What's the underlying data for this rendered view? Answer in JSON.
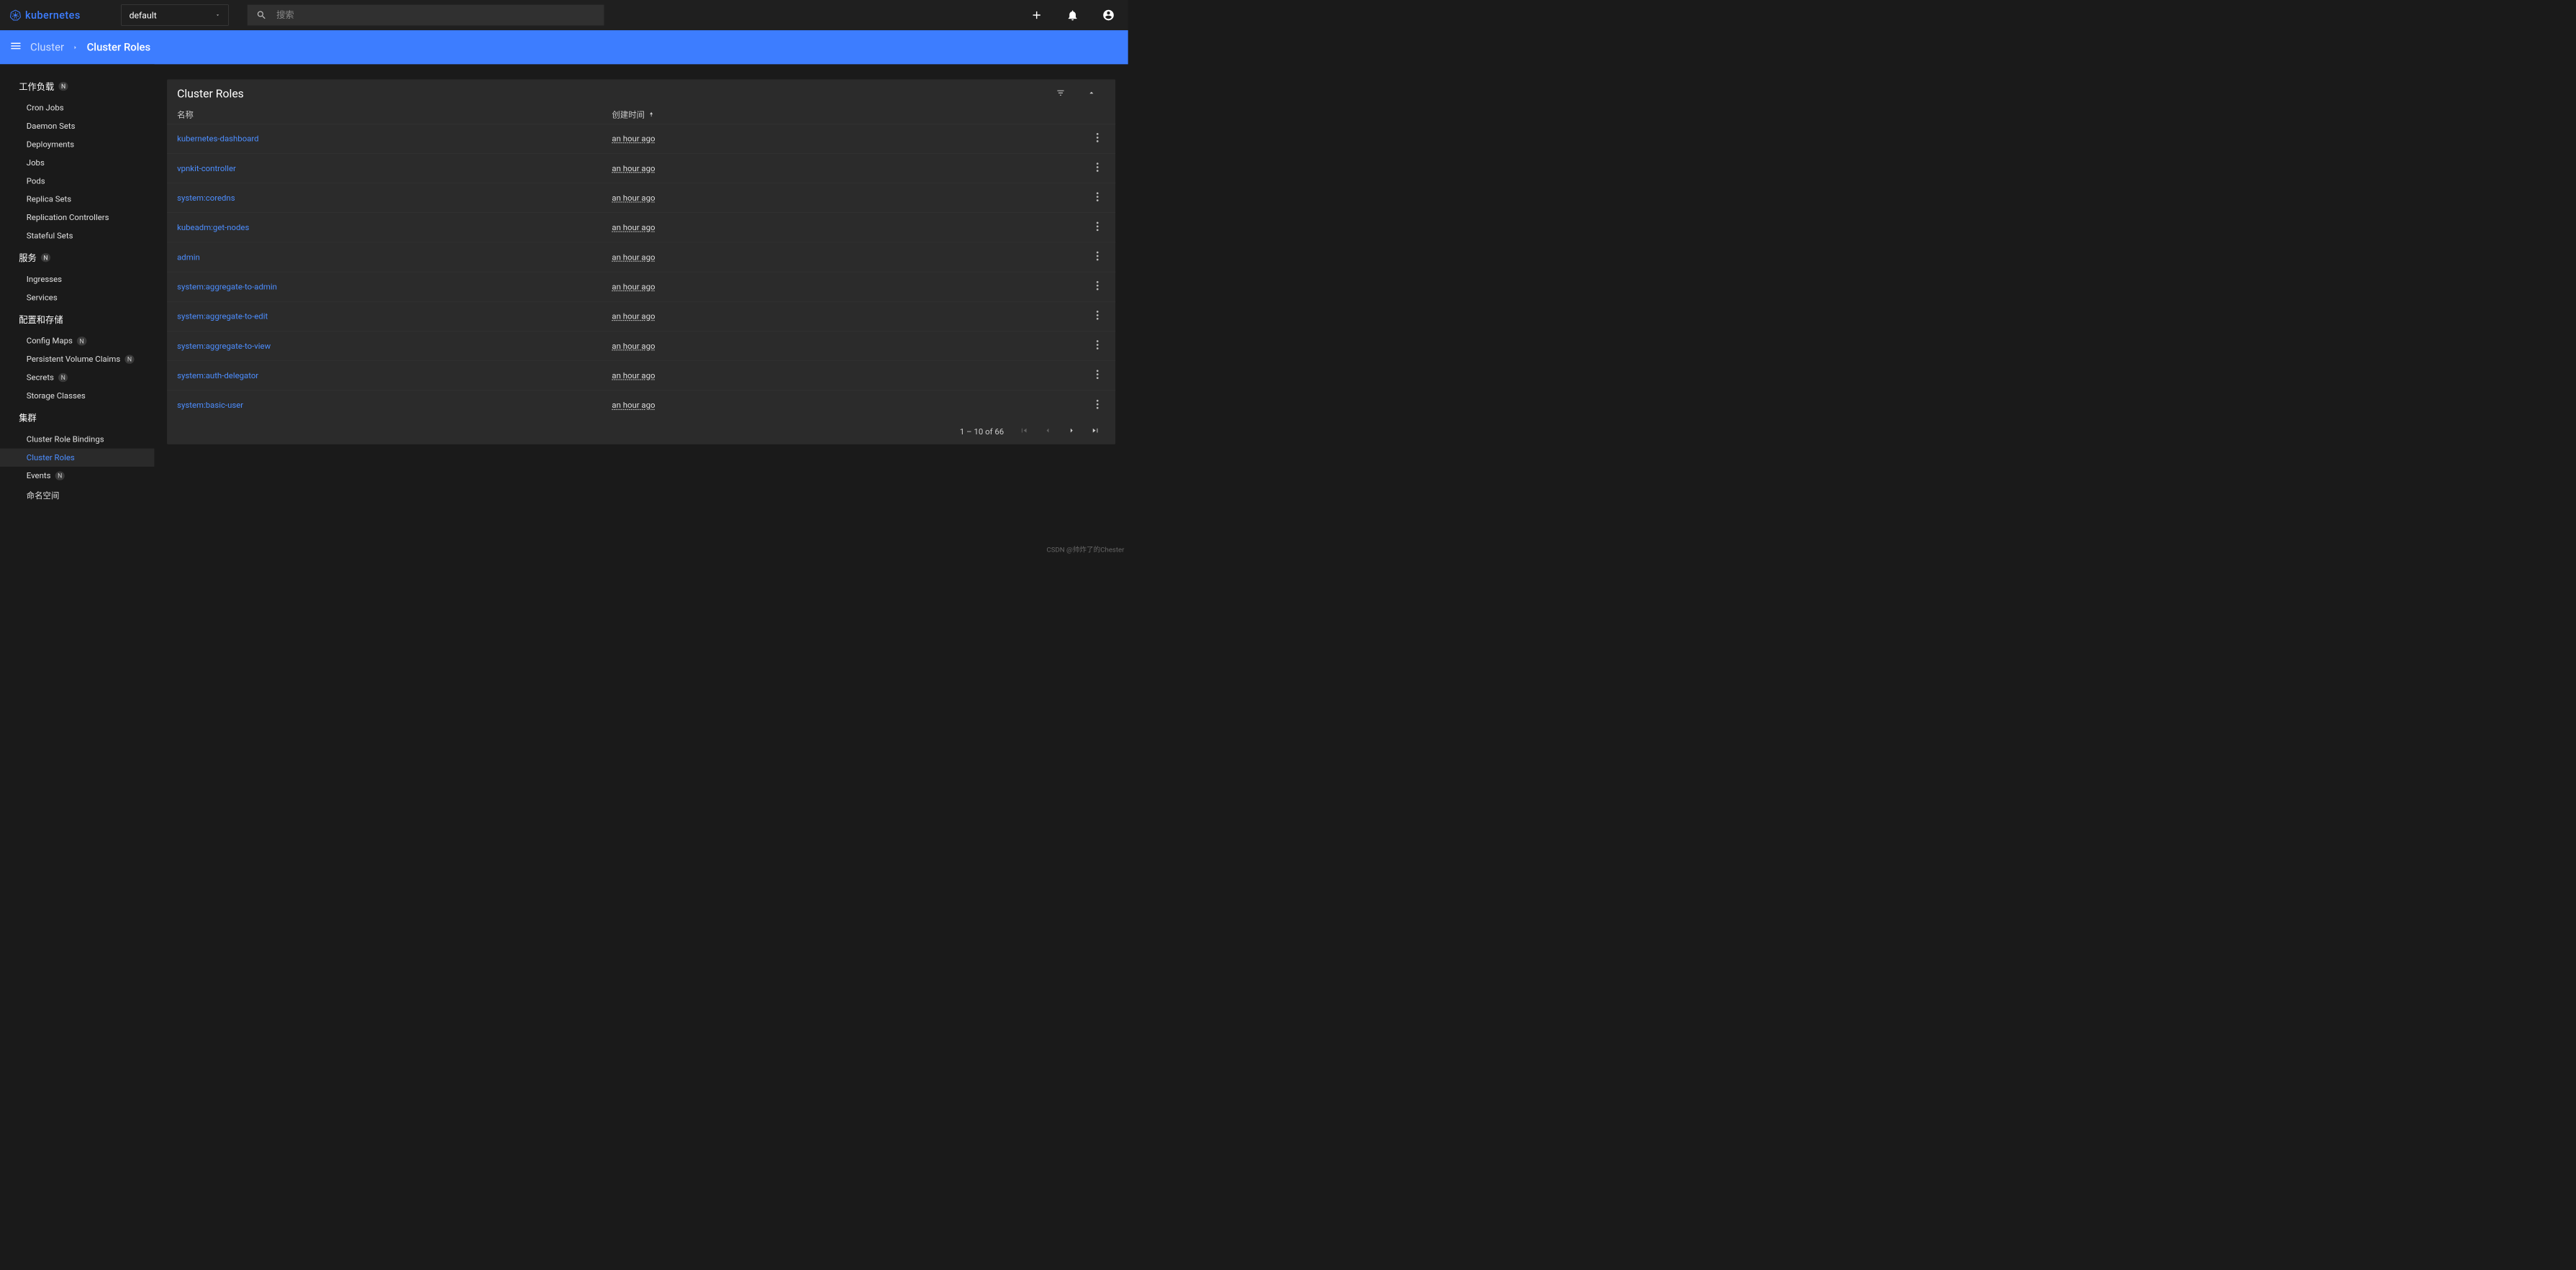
{
  "topbar": {
    "brand": "kubernetes",
    "namespace": "default",
    "search_placeholder": "搜索"
  },
  "breadcrumb": {
    "parent": "Cluster",
    "current": "Cluster Roles"
  },
  "sidebar": {
    "sections": [
      {
        "heading": "工作负载",
        "heading_badge": "N",
        "items": [
          {
            "label": "Cron Jobs"
          },
          {
            "label": "Daemon Sets"
          },
          {
            "label": "Deployments"
          },
          {
            "label": "Jobs"
          },
          {
            "label": "Pods"
          },
          {
            "label": "Replica Sets"
          },
          {
            "label": "Replication Controllers"
          },
          {
            "label": "Stateful Sets"
          }
        ]
      },
      {
        "heading": "服务",
        "heading_badge": "N",
        "items": [
          {
            "label": "Ingresses"
          },
          {
            "label": "Services"
          }
        ]
      },
      {
        "heading": "配置和存储",
        "items": [
          {
            "label": "Config Maps",
            "badge": "N"
          },
          {
            "label": "Persistent Volume Claims",
            "badge": "N"
          },
          {
            "label": "Secrets",
            "badge": "N"
          },
          {
            "label": "Storage Classes"
          }
        ]
      },
      {
        "heading": "集群",
        "items": [
          {
            "label": "Cluster Role Bindings"
          },
          {
            "label": "Cluster Roles",
            "active": true
          },
          {
            "label": "Events",
            "badge": "N"
          },
          {
            "label": "命名空间"
          }
        ]
      }
    ]
  },
  "table": {
    "title": "Cluster Roles",
    "columns": {
      "name": "名称",
      "created": "创建时间"
    },
    "rows": [
      {
        "name": "kubernetes-dashboard",
        "created": "an hour ago"
      },
      {
        "name": "vpnkit-controller",
        "created": "an hour ago"
      },
      {
        "name": "system:coredns",
        "created": "an hour ago"
      },
      {
        "name": "kubeadm:get-nodes",
        "created": "an hour ago"
      },
      {
        "name": "admin",
        "created": "an hour ago"
      },
      {
        "name": "system:aggregate-to-admin",
        "created": "an hour ago"
      },
      {
        "name": "system:aggregate-to-edit",
        "created": "an hour ago"
      },
      {
        "name": "system:aggregate-to-view",
        "created": "an hour ago"
      },
      {
        "name": "system:auth-delegator",
        "created": "an hour ago"
      },
      {
        "name": "system:basic-user",
        "created": "an hour ago"
      }
    ],
    "pagination": "1 – 10 of 66"
  },
  "watermark": "CSDN @帅炸了的Chester"
}
